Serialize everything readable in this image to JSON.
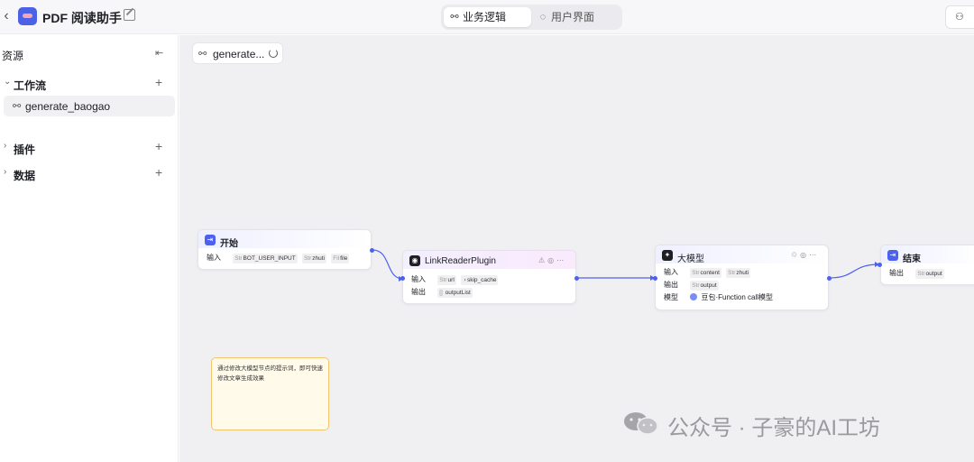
{
  "header": {
    "back_icon": "chevron-left-icon",
    "app_title": "PDF 阅读助手",
    "tabs": [
      {
        "label": "业务逻辑",
        "icon": "workflow-icon",
        "active": true
      },
      {
        "label": "用户界面",
        "icon": "palette-icon",
        "active": false
      }
    ],
    "share_label": "♀"
  },
  "sidebar": {
    "title": "资源",
    "groups": [
      {
        "label": "工作流",
        "expanded": true,
        "items": [
          {
            "label": "generate_baogao"
          }
        ]
      },
      {
        "label": "插件",
        "expanded": false
      },
      {
        "label": "数据",
        "expanded": false
      }
    ]
  },
  "canvas": {
    "workflow_tab": "generate...",
    "nodes": {
      "start": {
        "title": "开始",
        "rows": [
          {
            "label": "输入",
            "tags": [
              {
                "type": "Str",
                "name": "BOT_USER_INPUT"
              },
              {
                "type": "Str",
                "name": "zhuti"
              },
              {
                "type": "Fil",
                "name": "file"
              }
            ]
          }
        ]
      },
      "plugin": {
        "title": "LinkReaderPlugin",
        "rows": [
          {
            "label": "输入",
            "tags": [
              {
                "type": "Str",
                "name": "url"
              },
              {
                "type": "◑",
                "name": "skip_cache"
              }
            ]
          },
          {
            "label": "输出",
            "tags": [
              {
                "type": "[] ",
                "name": "outputList"
              }
            ]
          }
        ]
      },
      "llm": {
        "title": "大模型",
        "rows": [
          {
            "label": "输入",
            "tags": [
              {
                "type": "Str",
                "name": "content"
              },
              {
                "type": "Str",
                "name": "zhuti"
              }
            ]
          },
          {
            "label": "输出",
            "tags": [
              {
                "type": "Str",
                "name": "output"
              }
            ]
          },
          {
            "label": "模型",
            "model": "豆包·Function call模型"
          }
        ]
      },
      "end": {
        "title": "结束",
        "rows": [
          {
            "label": "输出",
            "tags": [
              {
                "type": "Str",
                "name": "output"
              }
            ]
          }
        ]
      }
    },
    "note": "通过修改大模型节点的提示词，即可快速修改文章生成效果"
  },
  "watermark": "公众号 · 子豪的AI工坊",
  "colors": {
    "accent": "#4d61f0",
    "canvas_bg": "#f0f0f3",
    "note_border": "#f2c46b",
    "note_bg": "#fffaea"
  }
}
